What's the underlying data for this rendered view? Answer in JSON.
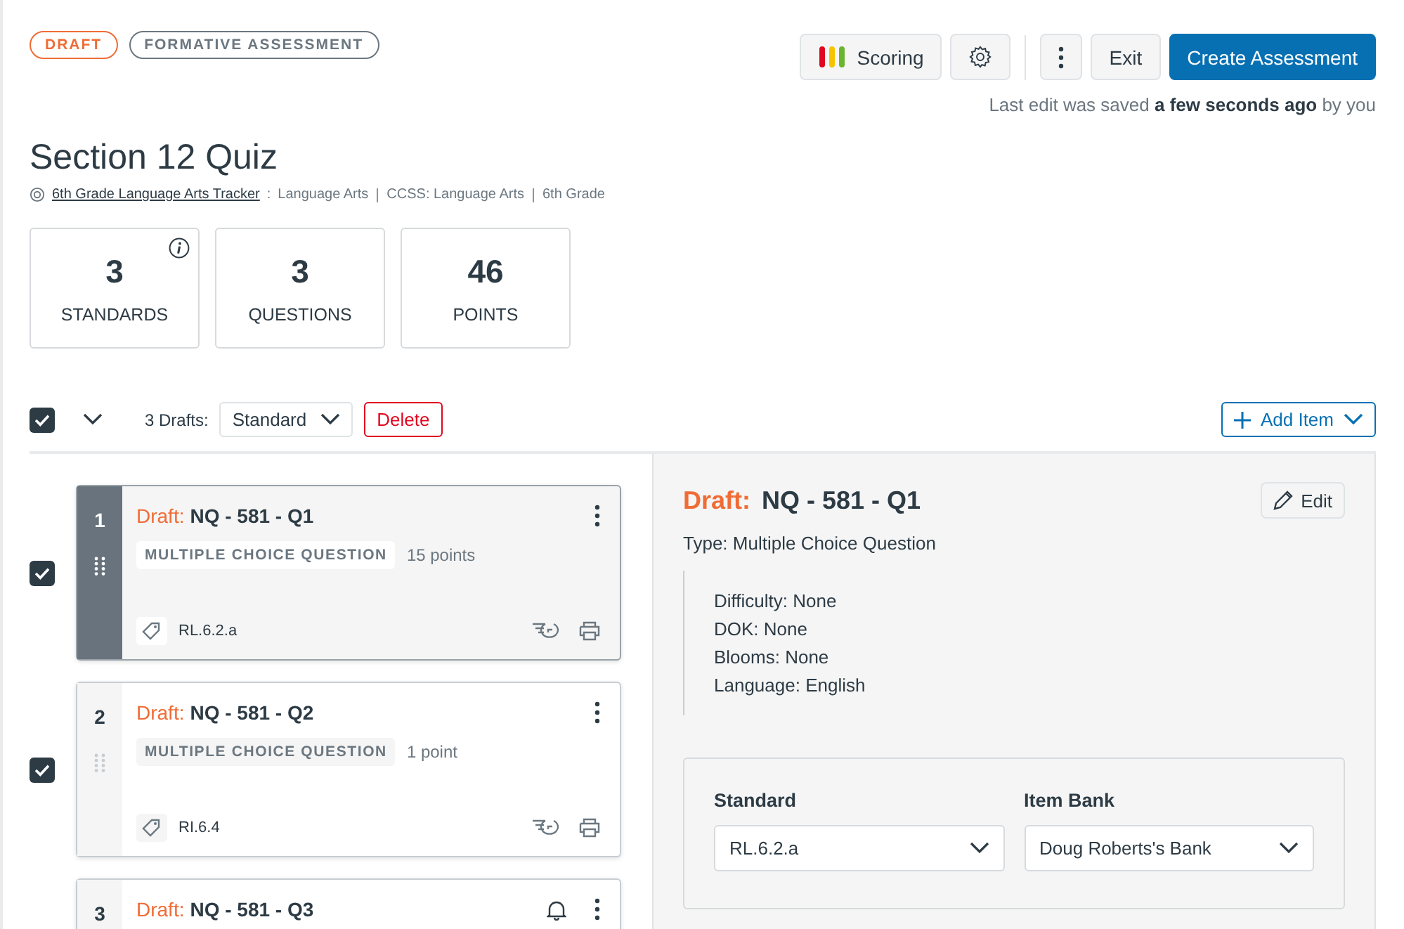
{
  "tags": [
    {
      "label": "DRAFT",
      "kind": "status"
    },
    {
      "label": "FORMATIVE ASSESSMENT",
      "kind": "type"
    }
  ],
  "toolbar": {
    "scoring": "Scoring",
    "exit": "Exit",
    "create": "Create Assessment"
  },
  "save_status": {
    "text": "Last edit was saved **a few seconds ago** by you"
  },
  "title": "Section 12 Quiz",
  "breadcrumb": {
    "link": "6th Grade Language Arts Tracker",
    "separator": ":",
    "parts": [
      "Language Arts",
      "CCSS: Language Arts",
      "6th Grade"
    ]
  },
  "stats": [
    {
      "value": "3",
      "label": "STANDARDS",
      "info": true
    },
    {
      "value": "3",
      "label": "QUESTIONS",
      "info": false
    },
    {
      "value": "46",
      "label": "POINTS",
      "info": false
    }
  ],
  "bulk": {
    "checked": true,
    "count_label": "3 Drafts:",
    "dropdown": "Standard",
    "delete": "Delete",
    "add_item": "Add Item"
  },
  "questions": [
    {
      "number": "1",
      "draft_label": "Draft:",
      "title": "NQ - 581 - Q1",
      "type": "MULTIPLE CHOICE QUESTION",
      "points": "15 points",
      "standard": "RL.6.2.a",
      "selected": true,
      "checked": true,
      "bell": false
    },
    {
      "number": "2",
      "draft_label": "Draft:",
      "title": "NQ - 581 - Q2",
      "type": "MULTIPLE CHOICE QUESTION",
      "points": "1 point",
      "standard": "RI.6.4",
      "selected": false,
      "checked": true,
      "bell": false
    },
    {
      "number": "3",
      "draft_label": "Draft:",
      "title": "NQ - 581 - Q3",
      "selected": false,
      "bell": true
    }
  ],
  "detail": {
    "draft_label": "Draft:",
    "title": "NQ - 581 - Q1",
    "edit": "Edit",
    "type": "Type: Multiple Choice Question",
    "metadata": [
      "Difficulty: None",
      "DOK: None",
      "Blooms: None",
      "Language: English"
    ],
    "fields": [
      {
        "label": "Standard",
        "value": "RL.6.2.a"
      },
      {
        "label": "Item Bank",
        "value": "Doug Roberts's Bank"
      }
    ]
  }
}
